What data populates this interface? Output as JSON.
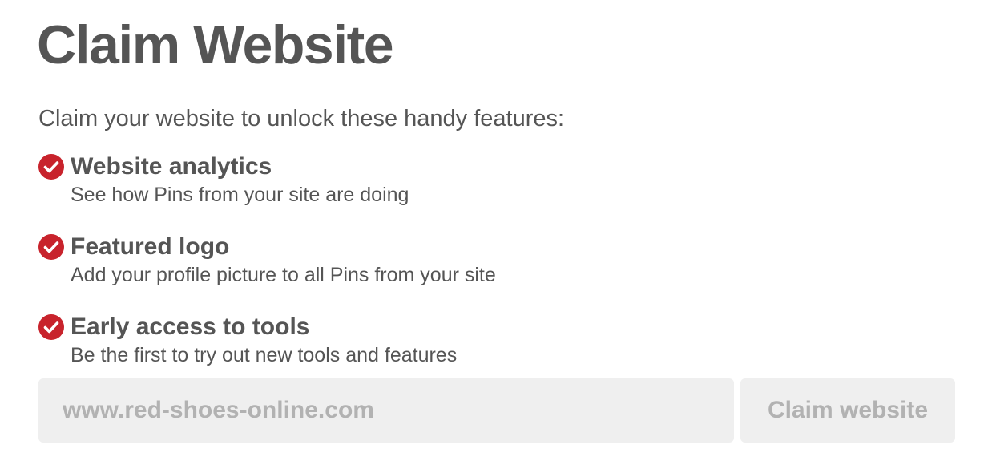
{
  "page_title": "Claim Website",
  "intro_text": "Claim your website to unlock these handy features:",
  "features": [
    {
      "icon": "check-circle-icon",
      "title": "Website analytics",
      "description": "See how Pins from your site are doing"
    },
    {
      "icon": "check-circle-icon",
      "title": "Featured logo",
      "description": "Add your profile picture to all Pins from your site"
    },
    {
      "icon": "check-circle-icon",
      "title": "Early access to tools",
      "description": "Be the first to try out new tools and features"
    }
  ],
  "form": {
    "website_placeholder": "www.red-shoes-online.com",
    "website_value": "",
    "submit_label": "Claim website",
    "submit_disabled": true
  },
  "colors": {
    "accent": "#c8232c",
    "text": "#555555",
    "field_background": "#efefef",
    "disabled_text": "#b2b2b2"
  }
}
